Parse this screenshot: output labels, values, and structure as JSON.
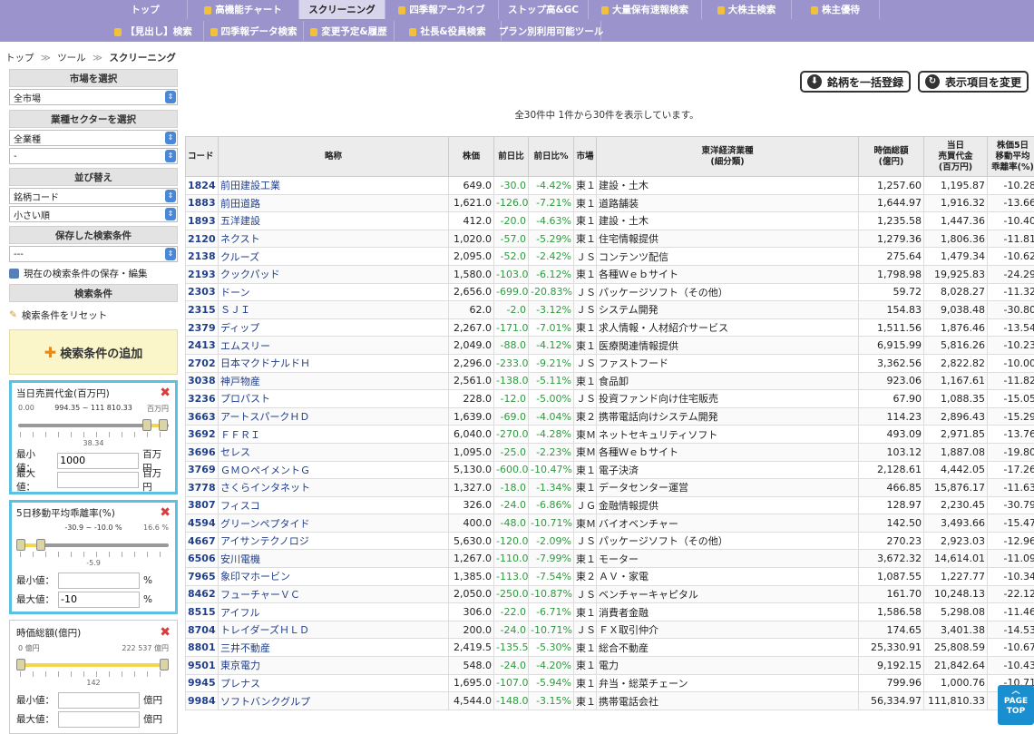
{
  "nav": {
    "row1": [
      {
        "label": "トップ",
        "lock": false
      },
      {
        "label": "高機能チャート",
        "lock": true
      },
      {
        "label": "スクリーニング",
        "lock": false
      },
      {
        "label": "四季報アーカイブ",
        "lock": true
      },
      {
        "label": "ストップ高&GC",
        "lock": false
      },
      {
        "label": "大量保有速報検索",
        "lock": true
      },
      {
        "label": "大株主検索",
        "lock": true
      },
      {
        "label": "株主優待",
        "lock": true
      }
    ],
    "row2": [
      {
        "label": "【見出し】検索",
        "lock": true
      },
      {
        "label": "四季報データ検索",
        "lock": true
      },
      {
        "label": "変更予定&履歴",
        "lock": true
      },
      {
        "label": "社長&役員検索",
        "lock": true
      },
      {
        "label": "プラン別利用可能ツール",
        "lock": false
      }
    ]
  },
  "breadcrumb": {
    "home": "トップ",
    "sep1": "≫",
    "tools": "ツール",
    "sep2": "≫",
    "current": "スクリーニング"
  },
  "sidebar": {
    "market_header": "市場を選択",
    "market_value": "全市場",
    "sector_header": "業種セクターを選択",
    "sector_value1": "全業種",
    "sector_value2": "-",
    "sort_header": "並び替え",
    "sort_value1": "銘柄コード",
    "sort_value2": "小さい順",
    "saved_header": "保存した検索条件",
    "saved_value": "---",
    "save_link": "現在の検索条件の保存・編集",
    "cond_header": "検索条件",
    "reset_link": "検索条件をリセット",
    "add_button": "検索条件の追加"
  },
  "filters": [
    {
      "title": "当日売買代金(百万円)",
      "min_label": "最小値：",
      "max_label": "最大値：",
      "min_value": "1000",
      "max_value": "",
      "unit": "百万円",
      "range_left": "0.00",
      "range_text": "994.35 ~ 111 810.33",
      "range_right": "百万円",
      "mid_label": "38.34",
      "level_low": 0.88,
      "level_high": 0.99
    },
    {
      "title": "5日移動平均乖離率(%)",
      "min_label": "最小値：",
      "max_label": "最大値：",
      "min_value": "",
      "max_value": "-10",
      "unit": "%",
      "range_left": "",
      "range_text": "-30.9 ~ -10.0 %",
      "range_right": "16.6 %",
      "mid_label": "-5.9",
      "level_low": 0.0,
      "level_high": 0.14
    },
    {
      "title": "時価総額(億円)",
      "min_label": "最小値：",
      "max_label": "最大値：",
      "min_value": "",
      "max_value": "",
      "unit": "億円",
      "range_left": "0 億円",
      "range_text": "",
      "range_right": "222 537 億円",
      "mid_label": "142",
      "level_low": 0.0,
      "level_high": 1.0
    }
  ],
  "toolbar": {
    "register": "銘柄を一括登録",
    "change_cols": "表示項目を変更"
  },
  "count_text": "全30件中 1件から30件を表示しています。",
  "table": {
    "headers": [
      "コード",
      "略称",
      "株価",
      "前日比",
      "前日比%",
      "市場",
      "東洋経済業種\n(細分類)",
      "時価総額\n(億円)",
      "当日\n売買代金\n(百万円)",
      "株価5日\n移動平均\n乖離率(%)"
    ],
    "rows": [
      [
        "1824",
        "前田建設工業",
        "649.0",
        "-30.0",
        "-4.42%",
        "東１",
        "建設・土木",
        "1,257.60",
        "1,195.87",
        "-10.28"
      ],
      [
        "1883",
        "前田道路",
        "1,621.0",
        "-126.0",
        "-7.21%",
        "東１",
        "道路舗装",
        "1,644.97",
        "1,916.32",
        "-13.66"
      ],
      [
        "1893",
        "五洋建設",
        "412.0",
        "-20.0",
        "-4.63%",
        "東１",
        "建設・土木",
        "1,235.58",
        "1,447.36",
        "-10.40"
      ],
      [
        "2120",
        "ネクスト",
        "1,020.0",
        "-57.0",
        "-5.29%",
        "東１",
        "住宅情報提供",
        "1,279.36",
        "1,806.36",
        "-11.81"
      ],
      [
        "2138",
        "クルーズ",
        "2,095.0",
        "-52.0",
        "-2.42%",
        "ＪＳ",
        "コンテンツ配信",
        "275.64",
        "1,479.34",
        "-10.62"
      ],
      [
        "2193",
        "クックパッド",
        "1,580.0",
        "-103.0",
        "-6.12%",
        "東１",
        "各種Ｗｅｂサイト",
        "1,798.98",
        "19,925.83",
        "-24.29"
      ],
      [
        "2303",
        "ドーン",
        "2,656.0",
        "-699.0",
        "-20.83%",
        "ＪＳ",
        "パッケージソフト（その他）",
        "59.72",
        "8,028.27",
        "-11.32"
      ],
      [
        "2315",
        "ＳＪＩ",
        "62.0",
        "-2.0",
        "-3.12%",
        "ＪＳ",
        "システム開発",
        "154.83",
        "9,038.48",
        "-30.80"
      ],
      [
        "2379",
        "ディップ",
        "2,267.0",
        "-171.0",
        "-7.01%",
        "東１",
        "求人情報・人材紹介サービス",
        "1,511.56",
        "1,876.46",
        "-13.54"
      ],
      [
        "2413",
        "エムスリー",
        "2,049.0",
        "-88.0",
        "-4.12%",
        "東１",
        "医療関連情報提供",
        "6,915.99",
        "5,816.26",
        "-10.23"
      ],
      [
        "2702",
        "日本マクドナルドＨ",
        "2,296.0",
        "-233.0",
        "-9.21%",
        "ＪＳ",
        "ファストフード",
        "3,362.56",
        "2,822.82",
        "-10.00"
      ],
      [
        "3038",
        "神戸物産",
        "2,561.0",
        "-138.0",
        "-5.11%",
        "東１",
        "食品卸",
        "923.06",
        "1,167.61",
        "-11.82"
      ],
      [
        "3236",
        "プロパスト",
        "228.0",
        "-12.0",
        "-5.00%",
        "ＪＳ",
        "投資ファンド向け住宅販売",
        "67.90",
        "1,088.35",
        "-15.05"
      ],
      [
        "3663",
        "アートスパークＨＤ",
        "1,639.0",
        "-69.0",
        "-4.04%",
        "東２",
        "携帯電話向けシステム開発",
        "114.23",
        "2,896.43",
        "-15.29"
      ],
      [
        "3692",
        "ＦＦＲＩ",
        "6,040.0",
        "-270.0",
        "-4.28%",
        "東Ｍ",
        "ネットセキュリティソフト",
        "493.09",
        "2,971.85",
        "-13.76"
      ],
      [
        "3696",
        "セレス",
        "1,095.0",
        "-25.0",
        "-2.23%",
        "東Ｍ",
        "各種Ｗｅｂサイト",
        "103.12",
        "1,887.08",
        "-19.80"
      ],
      [
        "3769",
        "ＧＭＯペイメントＧ",
        "5,130.0",
        "-600.0",
        "-10.47%",
        "東１",
        "電子決済",
        "2,128.61",
        "4,442.05",
        "-17.26"
      ],
      [
        "3778",
        "さくらインタネット",
        "1,327.0",
        "-18.0",
        "-1.34%",
        "東１",
        "データセンター運営",
        "466.85",
        "15,876.17",
        "-11.63"
      ],
      [
        "3807",
        "フィスコ",
        "326.0",
        "-24.0",
        "-6.86%",
        "ＪＧ",
        "金融情報提供",
        "128.97",
        "2,230.45",
        "-30.79"
      ],
      [
        "4594",
        "グリーンペプタイド",
        "400.0",
        "-48.0",
        "-10.71%",
        "東Ｍ",
        "バイオベンチャー",
        "142.50",
        "3,493.66",
        "-15.47"
      ],
      [
        "4667",
        "アイサンテクノロジ",
        "5,630.0",
        "-120.0",
        "-2.09%",
        "ＪＳ",
        "パッケージソフト（その他）",
        "270.23",
        "2,923.03",
        "-12.96"
      ],
      [
        "6506",
        "安川電機",
        "1,267.0",
        "-110.0",
        "-7.99%",
        "東１",
        "モーター",
        "3,672.32",
        "14,614.01",
        "-11.09"
      ],
      [
        "7965",
        "象印マホービン",
        "1,385.0",
        "-113.0",
        "-7.54%",
        "東２",
        "ＡＶ・家電",
        "1,087.55",
        "1,227.77",
        "-10.34"
      ],
      [
        "8462",
        "フューチャーＶＣ",
        "2,050.0",
        "-250.0",
        "-10.87%",
        "ＪＳ",
        "ベンチャーキャピタル",
        "161.70",
        "10,248.13",
        "-22.12"
      ],
      [
        "8515",
        "アイフル",
        "306.0",
        "-22.0",
        "-6.71%",
        "東１",
        "消費者金融",
        "1,586.58",
        "5,298.08",
        "-11.46"
      ],
      [
        "8704",
        "トレイダーズＨＬＤ",
        "200.0",
        "-24.0",
        "-10.71%",
        "ＪＳ",
        "ＦＸ取引仲介",
        "174.65",
        "3,401.38",
        "-14.53"
      ],
      [
        "8801",
        "三井不動産",
        "2,419.5",
        "-135.5",
        "-5.30%",
        "東１",
        "総合不動産",
        "25,330.91",
        "25,808.59",
        "-10.67"
      ],
      [
        "9501",
        "東京電力",
        "548.0",
        "-24.0",
        "-4.20%",
        "東１",
        "電力",
        "9,192.15",
        "21,842.64",
        "-10.43"
      ],
      [
        "9945",
        "プレナス",
        "1,695.0",
        "-107.0",
        "-5.94%",
        "東１",
        "弁当・総菜チェーン",
        "799.96",
        "1,000.76",
        "-10.71"
      ],
      [
        "9984",
        "ソフトバンクグルプ",
        "4,544.0",
        "-148.0",
        "-3.15%",
        "東１",
        "携帯電話会社",
        "56,334.97",
        "111,810.33",
        "-10.77"
      ]
    ]
  },
  "page_top": "PAGE\nTOP"
}
